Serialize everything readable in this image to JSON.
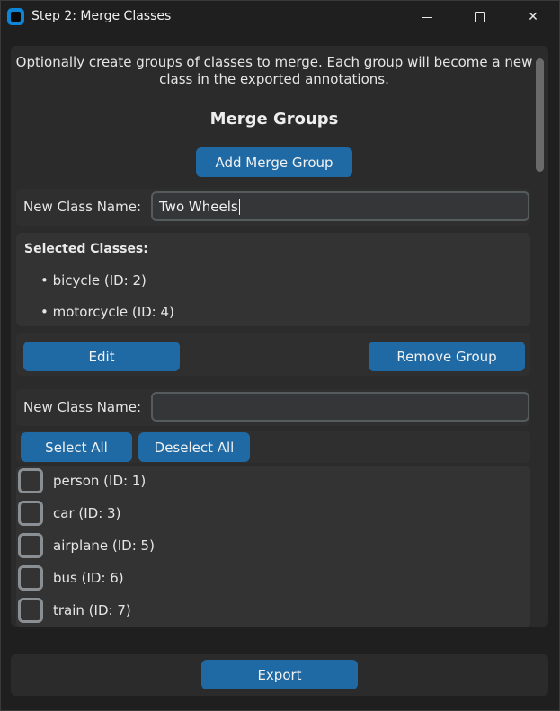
{
  "window": {
    "title": "Step 2: Merge Classes",
    "close_glyph": "✕",
    "app_icon": "app-icon"
  },
  "intro": {
    "line1": "Optionally create groups of classes to merge. Each group will become a new",
    "line2": "class in the exported annotations."
  },
  "merge_groups": {
    "title": "Merge Groups",
    "add_label": "Add Merge Group"
  },
  "group1": {
    "name_label": "New Class Name:",
    "name_value": "Two Wheels",
    "selected_title": "Selected Classes:",
    "selected": [
      "• bicycle (ID: 2)",
      "• motorcycle (ID: 4)"
    ],
    "edit_label": "Edit",
    "remove_label": "Remove Group"
  },
  "group2": {
    "name_label": "New Class Name:",
    "name_value": "",
    "select_all_label": "Select All",
    "deselect_all_label": "Deselect All",
    "classes": [
      {
        "label": "person (ID: 1)",
        "checked": false
      },
      {
        "label": "car (ID: 3)",
        "checked": false
      },
      {
        "label": "airplane (ID: 5)",
        "checked": false
      },
      {
        "label": "bus (ID: 6)",
        "checked": false
      },
      {
        "label": "train (ID: 7)",
        "checked": false
      }
    ]
  },
  "footer": {
    "export_label": "Export"
  },
  "colors": {
    "accent": "#1f6aa5",
    "background": "#1f1f1f",
    "panel": "#2b2b2b"
  }
}
